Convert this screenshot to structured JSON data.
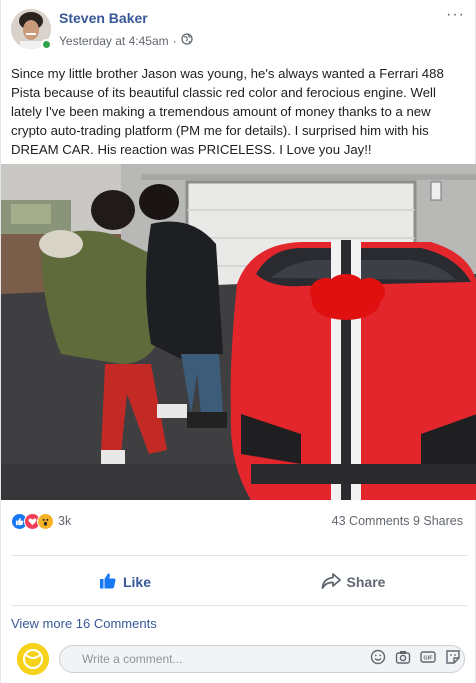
{
  "post": {
    "author": "Steven Baker",
    "timestamp": "Yesterday at 4:45am",
    "separator": "·",
    "privacy_icon": "globe-icon",
    "more_label": "···",
    "text": "Since my little brother Jason was young, he's always wanted a Ferrari 488 Pista because of its beautiful classic red color and ferocious engine. Well lately I've been making a tremendous amount of money thanks to a new crypto auto-trading platform (PM me for details). I surprised him with his DREAM CAR. His reaction was PRICELESS. I Love you Jay!!"
  },
  "reactions": {
    "icons": [
      "like-icon",
      "love-icon",
      "wow-icon"
    ],
    "count": "3k",
    "comments": "43 Comments",
    "shares": "9 Shares"
  },
  "actions": {
    "like_label": "Like",
    "share_label": "Share"
  },
  "comments": {
    "view_more": "View more 16 Comments",
    "placeholder": "Write a comment..."
  },
  "colors": {
    "link_blue": "#385898",
    "like_blue": "#1877f2",
    "online_green": "#31a24c",
    "love_red": "#f33e58",
    "wow_yellow": "#f7b125",
    "car_red": "#e3262b"
  }
}
